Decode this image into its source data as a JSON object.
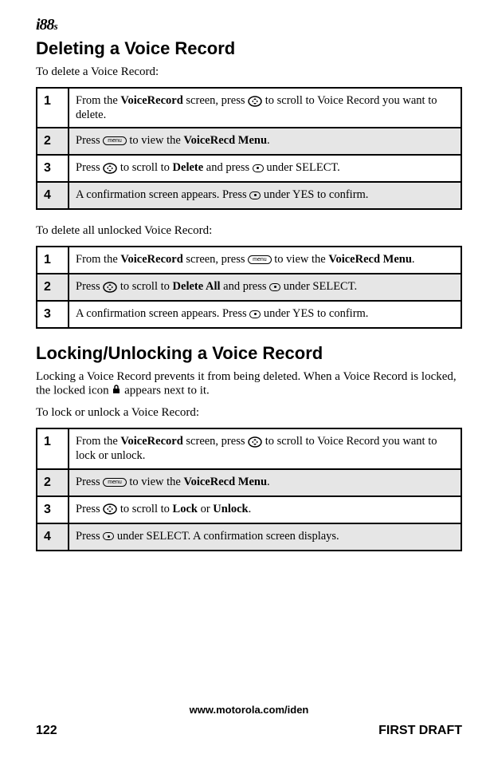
{
  "logo": {
    "main": "i88",
    "sub": "s"
  },
  "section1": {
    "title": "Deleting a Voice Record",
    "intro1": "To delete a Voice Record:",
    "steps1": [
      {
        "n": "1",
        "pre": "From the ",
        "b1": "VoiceRecord",
        "mid": " screen, press ",
        "icon": "nav",
        "post": " to scroll to Voice Record you want to delete."
      },
      {
        "n": "2",
        "pre": "Press ",
        "icon": "menu",
        "mid": " to view the ",
        "b1": "VoiceRecd Menu",
        "post": "."
      },
      {
        "n": "3",
        "pre": "Press ",
        "icon": "nav",
        "mid": " to scroll to ",
        "b1": "Delete",
        "mid2": " and press ",
        "icon2": "dot",
        "post": " under SELECT."
      },
      {
        "n": "4",
        "pre": "A confirmation screen appears. Press ",
        "icon": "dot",
        "post": " under YES to confirm."
      }
    ],
    "intro2": "To delete all unlocked Voice Record:",
    "steps2": [
      {
        "n": "1",
        "pre": "From the ",
        "b1": "VoiceRecord",
        "mid": " screen, press ",
        "icon": "menu",
        "mid2": " to view the ",
        "b2": "VoiceRecd Menu",
        "post": "."
      },
      {
        "n": "2",
        "pre": "Press ",
        "icon": "nav",
        "mid": " to scroll to ",
        "b1": "Delete All",
        "mid2": " and press ",
        "icon2": "dot",
        "post": " under SELECT."
      },
      {
        "n": "3",
        "pre": "A confirmation screen appears. Press ",
        "icon": "dot",
        "post": " under YES to confirm."
      }
    ]
  },
  "section2": {
    "title": "Locking/Unlocking a Voice Record",
    "desc_pre": "Locking a Voice Record prevents it from being deleted. When a Voice Record is locked, the locked icon ",
    "desc_post": " appears next to it.",
    "intro": "To lock or unlock a Voice Record:",
    "steps": [
      {
        "n": "1",
        "pre": "From the ",
        "b1": "VoiceRecord",
        "mid": " screen, press ",
        "icon": "nav",
        "post": " to scroll to Voice Record you want to lock or unlock."
      },
      {
        "n": "2",
        "pre": "Press ",
        "icon": "menu",
        "mid": " to view the ",
        "b1": "VoiceRecd Menu",
        "post": "."
      },
      {
        "n": "3",
        "pre": "Press ",
        "icon": "nav",
        "mid": " to scroll to ",
        "b1": "Lock",
        "mid2": " or ",
        "b2": "Unlock",
        "post": "."
      },
      {
        "n": "4",
        "pre": "Press ",
        "icon": "dot",
        "post": " under SELECT. A confirmation screen displays."
      }
    ]
  },
  "footer": {
    "url": "www.motorola.com/iden",
    "page": "122",
    "draft": "FIRST DRAFT"
  }
}
